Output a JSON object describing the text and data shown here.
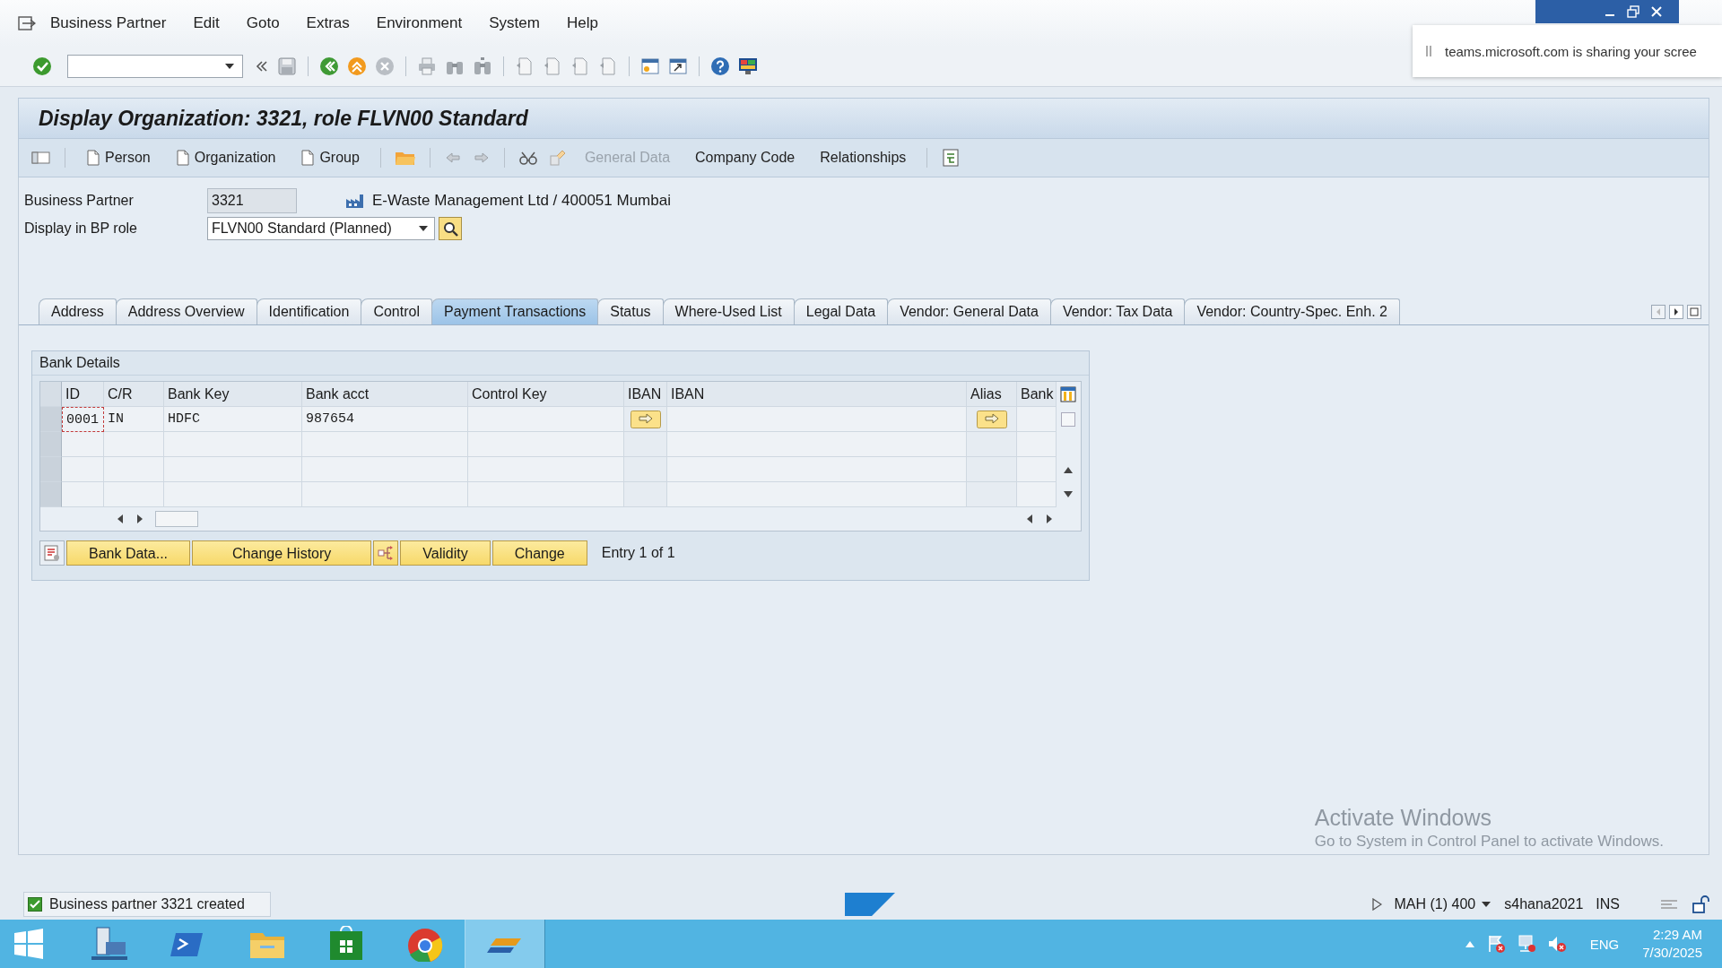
{
  "menu": [
    "Business Partner",
    "Edit",
    "Goto",
    "Extras",
    "Environment",
    "System",
    "Help"
  ],
  "notification": {
    "text": "teams.microsoft.com is sharing your scree"
  },
  "title": "Display Organization: 3321, role FLVN00 Standard",
  "app_toolbar": [
    {
      "kind": "page",
      "label": "Person",
      "disabled": false
    },
    {
      "kind": "page",
      "label": "Organization",
      "disabled": false
    },
    {
      "kind": "page",
      "label": "Group",
      "disabled": false
    },
    {
      "kind": "text",
      "label": "General Data",
      "disabled": true
    },
    {
      "kind": "text",
      "label": "Company Code",
      "disabled": false
    },
    {
      "kind": "text",
      "label": "Relationships",
      "disabled": false
    }
  ],
  "fields": [
    {
      "kind": "display",
      "label": "Business Partner",
      "value": "3321",
      "description": "E-Waste Management Ltd / 400051 Mumbai"
    },
    {
      "kind": "dropdown",
      "label": "Display in BP role",
      "value": "FLVN00 Standard (Planned)"
    }
  ],
  "tabs": [
    {
      "label": "Address",
      "selected": false
    },
    {
      "label": "Address Overview",
      "selected": false
    },
    {
      "label": "Identification",
      "selected": false
    },
    {
      "label": "Control",
      "selected": false
    },
    {
      "label": "Payment Transactions",
      "selected": true
    },
    {
      "label": "Status",
      "selected": false
    },
    {
      "label": "Where-Used List",
      "selected": false
    },
    {
      "label": "Legal Data",
      "selected": false
    },
    {
      "label": "Vendor: General Data",
      "selected": false
    },
    {
      "label": "Vendor: Tax Data",
      "selected": false
    },
    {
      "label": "Vendor: Country-Spec. Enh. 2",
      "selected": false
    }
  ],
  "bank_details": {
    "title": "Bank Details",
    "columns": [
      {
        "label": "ID",
        "kind": "text"
      },
      {
        "label": "C/R",
        "kind": "text"
      },
      {
        "label": "Bank Key",
        "kind": "text"
      },
      {
        "label": "Bank acct",
        "kind": "text"
      },
      {
        "label": "Control Key",
        "kind": "text"
      },
      {
        "label": "IBAN",
        "kind": "button"
      },
      {
        "label": "IBAN",
        "kind": "text"
      },
      {
        "label": "Alias",
        "kind": "button"
      },
      {
        "label": "Bank",
        "kind": "text"
      }
    ],
    "rows": [
      {
        "cells": [
          "0001",
          "IN",
          "HDFC",
          "987654"
        ]
      }
    ],
    "buttons": [
      {
        "kind": "icon"
      },
      {
        "kind": "text",
        "label": "Bank Data..."
      },
      {
        "kind": "text",
        "label": "Change History"
      },
      {
        "kind": "icon"
      },
      {
        "kind": "text",
        "label": "Validity"
      },
      {
        "kind": "text",
        "label": "Change"
      }
    ],
    "entry": "Entry 1 of 1"
  },
  "activation": {
    "title": "Activate Windows",
    "text": "Go to System in Control Panel to activate Windows."
  },
  "status_bar": {
    "message": "Business partner 3321 created",
    "system": "MAH (1) 400",
    "server": "s4hana2021",
    "mode": "INS"
  },
  "taskbar": {
    "language": "ENG",
    "time": "2:29 AM",
    "date": "7/30/2025"
  }
}
